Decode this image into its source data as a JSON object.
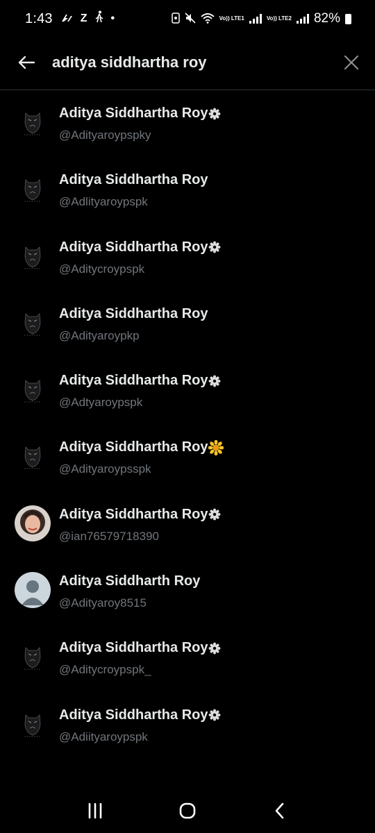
{
  "status_bar": {
    "time": "1:43",
    "z_label": "Z",
    "dot": "•",
    "lte1": "Vo)) LTE1",
    "lte2": "Vo)) LTE2",
    "battery": "82%"
  },
  "search": {
    "query": "aditya siddhartha roy"
  },
  "results": [
    {
      "name": "Aditya Siddhartha Roy",
      "handle": "@Adityaroypspky",
      "avatar": "panther",
      "badge": "gear"
    },
    {
      "name": "Aditya Siddhartha Roy",
      "handle": "@Adlityaroypspk",
      "avatar": "panther",
      "badge": "none"
    },
    {
      "name": "Aditya Siddhartha Roy",
      "handle": "@Aditycroypspk",
      "avatar": "panther",
      "badge": "gear"
    },
    {
      "name": "Aditya Siddhartha Roy",
      "handle": "@Adityaroypkp",
      "avatar": "panther",
      "badge": "none"
    },
    {
      "name": "Aditya Siddhartha Roy",
      "handle": "@Adtyaroypspk",
      "avatar": "panther",
      "badge": "gear"
    },
    {
      "name": "Aditya Siddhartha Roy",
      "handle": "@Adityaroypsspk",
      "avatar": "panther",
      "badge": "sunflower"
    },
    {
      "name": "Aditya Siddhartha Roy",
      "handle": "@ian76579718390",
      "avatar": "photo",
      "badge": "gear"
    },
    {
      "name": "Aditya Siddharth Roy",
      "handle": "@Adityaroy8515",
      "avatar": "default",
      "badge": "none"
    },
    {
      "name": "Aditya Siddhartha Roy",
      "handle": "@Aditycroypspk_",
      "avatar": "panther",
      "badge": "gear"
    },
    {
      "name": "Aditya Siddhartha Roy",
      "handle": "@Adiityaroypspk",
      "avatar": "panther",
      "badge": "gear"
    }
  ],
  "icons": {
    "back": "arrow-left-icon",
    "clear": "close-icon",
    "nav_recents": "recent-apps-icon",
    "nav_home": "home-icon",
    "nav_back": "back-icon"
  },
  "colors": {
    "background": "#000000",
    "text": "#e7e9ea",
    "secondary_text": "#71767b",
    "divider": "#2f3336",
    "badge_gear": "#dcdcdc",
    "badge_sunflower": "#f7c325"
  }
}
